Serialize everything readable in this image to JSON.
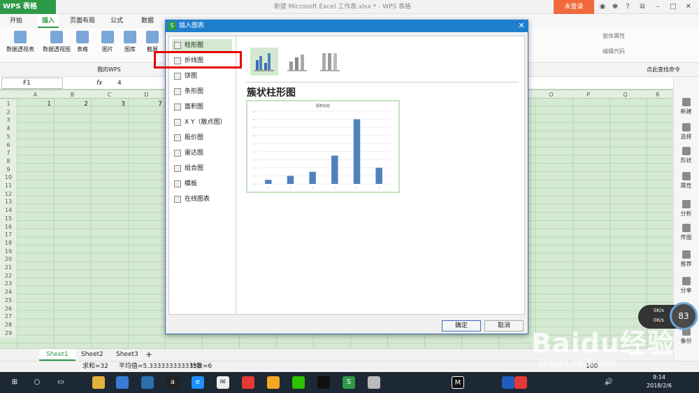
{
  "app": {
    "logo": "WPS 表格",
    "doc_title": "新建 Microsoft Excel 工作表.xlsx * - WPS 表格",
    "login": "未登录"
  },
  "menu": [
    "开始",
    "插入",
    "页面布局",
    "公式",
    "数据"
  ],
  "ribbon": {
    "left": [
      "数据透视表",
      "数据透视图",
      "表格",
      "图片",
      "图库",
      "截屏"
    ],
    "right": [
      "窗体属性",
      "编辑代码"
    ]
  },
  "qbar": {
    "tab1": "我的WPS",
    "search": "点此查找命令"
  },
  "formula": {
    "cell": "F1",
    "fx": "fx",
    "value": "4"
  },
  "columns": [
    "A",
    "B",
    "C",
    "D",
    "O",
    "P",
    "Q",
    "R"
  ],
  "rows": [
    "1",
    "2",
    "3",
    "4",
    "5",
    "6",
    "7",
    "8",
    "9",
    "10",
    "11",
    "12",
    "13",
    "14",
    "15",
    "16",
    "17",
    "18",
    "19",
    "20",
    "21",
    "22",
    "23",
    "24",
    "25",
    "26",
    "27",
    "28",
    "29"
  ],
  "row1_values": [
    "1",
    "2",
    "3",
    "7"
  ],
  "dialog": {
    "title": "插入图表",
    "categories": [
      "柱形图",
      "折线图",
      "饼图",
      "条形图",
      "面积图",
      "X Y（散点图）",
      "股价图",
      "雷达图",
      "组合图",
      "模板",
      "在线图表"
    ],
    "selected_category": "柱形图",
    "variant_title": "簇状柱形图",
    "ok": "确定",
    "cancel": "取消",
    "preview_title": "图表标题"
  },
  "chart_data": {
    "type": "bar",
    "categories": [
      "1",
      "2",
      "3",
      "4",
      "5",
      "6"
    ],
    "values": [
      1,
      2,
      3,
      7,
      16,
      4
    ],
    "title": "图表标题",
    "ylim": [
      0,
      18
    ]
  },
  "right_panel": [
    "新建",
    "选择",
    "形状",
    "属性",
    "分析",
    "传图",
    "推荐",
    "分享",
    "备份"
  ],
  "sheets": [
    "Sheet1",
    "Sheet2",
    "Sheet3"
  ],
  "status": {
    "sum": "求和=32",
    "avg": "平均值=5.3333333333333",
    "count": "计数=6",
    "zoom": "100"
  },
  "clock": {
    "time": "9:14",
    "date": "2018/2/6"
  },
  "net": {
    "up": "0K/s",
    "down": "0K/s",
    "cpu": "83"
  },
  "watermark": {
    "text": "Baidu经验",
    "url": "jingyan.baidu.com"
  },
  "colors": {
    "green": "#2e9a48",
    "dialog_blue": "#1f7fcf",
    "bar": "#4f81bd",
    "highlight": "#e60000"
  }
}
